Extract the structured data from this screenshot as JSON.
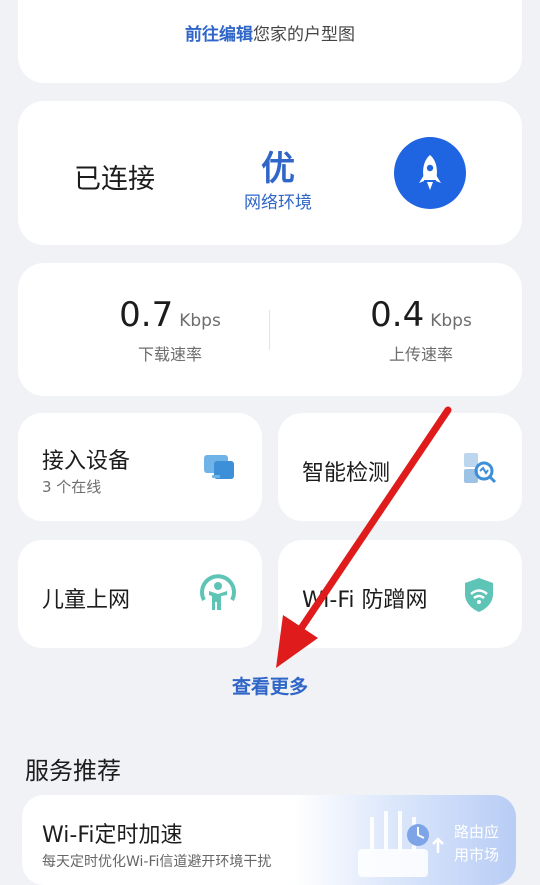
{
  "floorplan": {
    "link_text": "前往编辑",
    "rest_text": "您家的户型图"
  },
  "connection": {
    "status": "已连接",
    "quality_grade": "优",
    "quality_label": "网络环境",
    "rocket_icon": "rocket-icon",
    "accent_color": "#1f64e0"
  },
  "speed": {
    "download": {
      "value": "0.7",
      "unit": "Kbps",
      "label": "下载速率"
    },
    "upload": {
      "value": "0.4",
      "unit": "Kbps",
      "label": "上传速率"
    }
  },
  "tiles": [
    {
      "title": "接入设备",
      "subtitle": "3 个在线",
      "icon": "devices-icon"
    },
    {
      "title": "智能检测",
      "icon": "smart-detect-icon"
    },
    {
      "title": "儿童上网",
      "icon": "child-icon"
    },
    {
      "title": "Wi-Fi 防蹭网",
      "icon": "wifi-shield-icon"
    }
  ],
  "view_more": "查看更多",
  "services": {
    "heading": "服务推荐",
    "card": {
      "title": "Wi-Fi定时加速",
      "description": "每天定时优化Wi-Fi信道避开环境干扰",
      "market_label_line1": "路由应",
      "market_label_line2": "用市场"
    }
  },
  "annotation": {
    "arrow_color": "#e01b1b"
  }
}
